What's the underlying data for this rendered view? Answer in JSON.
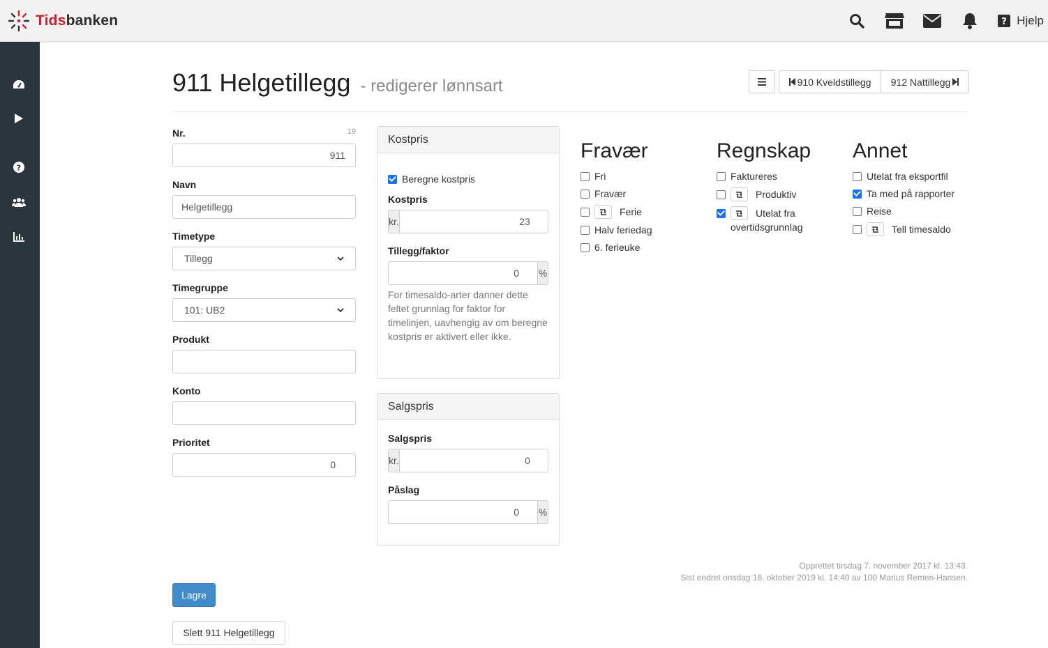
{
  "app": {
    "brand_part1": "Tids",
    "brand_part2": "banken",
    "help_label": "Hjelp"
  },
  "colors": {
    "brand_red": "#c8202f",
    "sidebar": "#2c353d",
    "primary": "#428bca",
    "checkbox": "#1a73e8"
  },
  "header_icons": [
    "search-icon",
    "store-icon",
    "envelope-icon",
    "bell-icon",
    "question-square-icon"
  ],
  "sidebar_icons": [
    "dashboard-icon",
    "play-icon",
    "question-circle-icon",
    "users-icon",
    "chart-icon"
  ],
  "page": {
    "title": "911 Helgetillegg",
    "subtitle": "- redigerer lønnsart",
    "prev_label": "910 Kveldstillegg",
    "next_label": "912 Nattillegg"
  },
  "form": {
    "nr_label": "Nr.",
    "nr_count": "19",
    "nr_value": "911",
    "navn_label": "Navn",
    "navn_value": "Helgetillegg",
    "timetype_label": "Timetype",
    "timetype_value": "Tillegg",
    "timegruppe_label": "Timegruppe",
    "timegruppe_value": "101: UB2",
    "produkt_label": "Produkt",
    "produkt_value": "",
    "konto_label": "Konto",
    "konto_value": "",
    "prioritet_label": "Prioritet",
    "prioritet_value": "0"
  },
  "kostpris": {
    "heading": "Kostpris",
    "beregne_label": "Beregne kostpris",
    "beregne_checked": true,
    "kostpris_label": "Kostpris",
    "currency": "kr.",
    "kostpris_value": "23",
    "tillegg_label": "Tillegg/faktor",
    "tillegg_value": "0",
    "percent": "%",
    "help": "For timesaldo-arter danner dette feltet grunnlag for faktor for timelinjen, uavhengig av om beregne kostpris er aktivert eller ikke."
  },
  "salgspris": {
    "heading": "Salgspris",
    "salgspris_label": "Salgspris",
    "currency": "kr.",
    "salgspris_value": "0",
    "paslag_label": "Påslag",
    "paslag_value": "0",
    "percent": "%"
  },
  "fravaer": {
    "heading": "Fravær",
    "items": [
      {
        "label": "Fri",
        "checked": false,
        "recalc": false
      },
      {
        "label": "Fravær",
        "checked": false,
        "recalc": false
      },
      {
        "label": "Ferie",
        "checked": false,
        "recalc": true
      },
      {
        "label": "Halv feriedag",
        "checked": false,
        "recalc": false
      },
      {
        "label": "6. ferieuke",
        "checked": false,
        "recalc": false
      }
    ]
  },
  "regnskap": {
    "heading": "Regnskap",
    "items": [
      {
        "label": "Faktureres",
        "checked": false,
        "recalc": false
      },
      {
        "label": "Produktiv",
        "checked": false,
        "recalc": true
      },
      {
        "label": "Utelat fra",
        "label2": "overtidsgrunnlag",
        "checked": true,
        "recalc": true
      }
    ]
  },
  "annet": {
    "heading": "Annet",
    "items": [
      {
        "label": "Utelat fra eksportfil",
        "checked": false,
        "recalc": false
      },
      {
        "label": "Ta med på rapporter",
        "checked": true,
        "recalc": false
      },
      {
        "label": "Reise",
        "checked": false,
        "recalc": false
      },
      {
        "label": "Tell timesaldo",
        "checked": false,
        "recalc": true
      }
    ]
  },
  "meta": {
    "created": "Opprettet tirsdag 7. november 2017 kl. 13:43.",
    "modified": "Sist endret onsdag 16. oktober 2019 kl. 14:40 av 100 Marius Remen-Hansen."
  },
  "actions": {
    "save_label": "Lagre",
    "delete_label": "Slett 911 Helgetillegg"
  }
}
